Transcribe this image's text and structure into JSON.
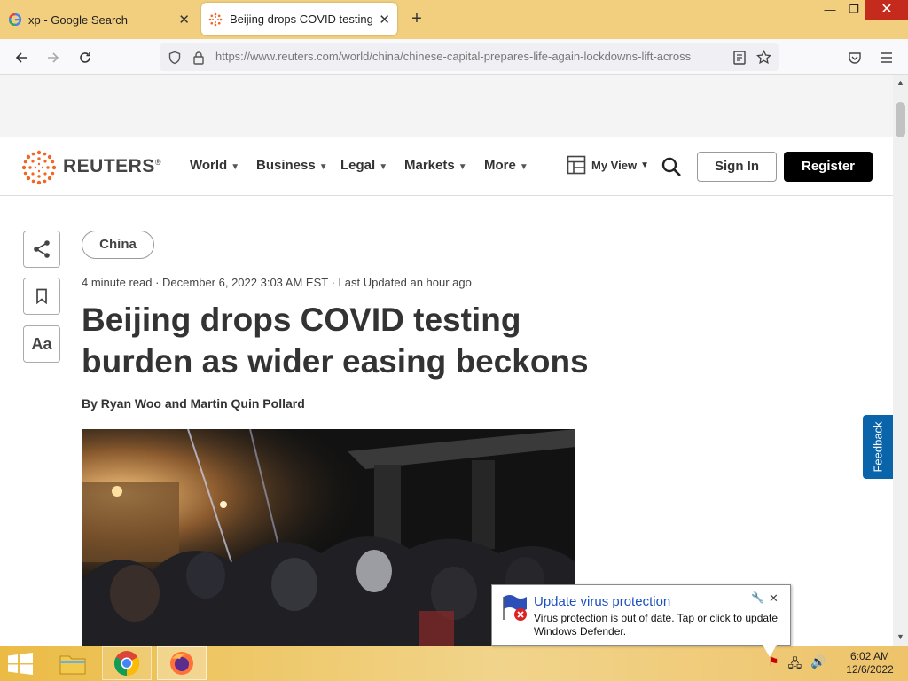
{
  "browser": {
    "tabs": [
      {
        "title": "xp - Google Search",
        "favicon": "google-icon"
      },
      {
        "title": "Beijing drops COVID testing bur",
        "favicon": "reuters-icon",
        "active": true
      }
    ],
    "url": "https://www.reuters.com/world/china/chinese-capital-prepares-life-again-lockdowns-lift-across"
  },
  "site": {
    "logo_text": "REUTERS",
    "registered": "®",
    "nav": [
      "World",
      "Business",
      "Legal",
      "Markets",
      "More"
    ],
    "my_view": "My View",
    "sign_in": "Sign In",
    "register": "Register"
  },
  "article": {
    "tag": "China",
    "meta": "4 minute read · December 6, 2022 3:03 AM EST · Last Updated an hour ago",
    "headline_line1": "Beijing drops COVID testing",
    "headline_line2": "burden as wider easing beckons",
    "byline": "By Ryan Woo and Martin Quin Pollard",
    "text_size_label": "Aa"
  },
  "feedback_label": "Feedback",
  "notification": {
    "title": "Update virus protection",
    "message": "Virus protection is out of date. Tap or click to update Windows Defender."
  },
  "taskbar": {
    "time": "6:02 AM",
    "date": "12/6/2022"
  },
  "colors": {
    "tab_strip": "#f2cf7e",
    "register_bg": "#000000",
    "feedback_bg": "#0a64a9",
    "reuters_orange": "#f26522",
    "close_red": "#c42b1c"
  }
}
